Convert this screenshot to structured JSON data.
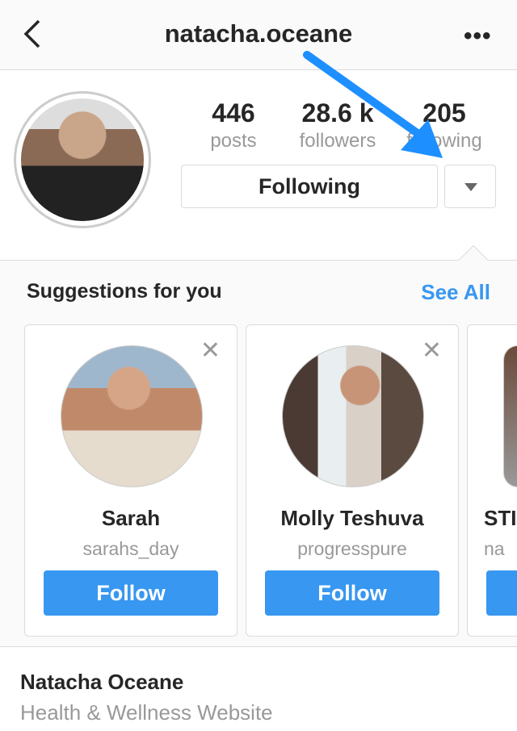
{
  "header": {
    "title": "natacha.oceane",
    "back_icon": "chevron-left-icon",
    "more_icon": "more-horizontal-icon"
  },
  "profile": {
    "stats": [
      {
        "value": "446",
        "label": "posts"
      },
      {
        "value": "28.6 k",
        "label": "followers"
      },
      {
        "value": "205",
        "label": "following"
      }
    ],
    "following_button": "Following",
    "dropdown_icon": "triangle-down-icon"
  },
  "annotation": {
    "arrow_color": "#1e8fff"
  },
  "suggestions": {
    "title": "Suggestions for you",
    "see_all": "See All",
    "cards": [
      {
        "name": "Sarah",
        "username": "sarahs_day",
        "follow": "Follow"
      },
      {
        "name": "Molly Teshuva",
        "username": "progresspure",
        "follow": "Follow"
      },
      {
        "name": "STI",
        "username": "na",
        "follow": ""
      }
    ]
  },
  "bio": {
    "name": "Natacha Oceane",
    "category": "Health & Wellness Website"
  },
  "colors": {
    "accent": "#3897f0"
  }
}
